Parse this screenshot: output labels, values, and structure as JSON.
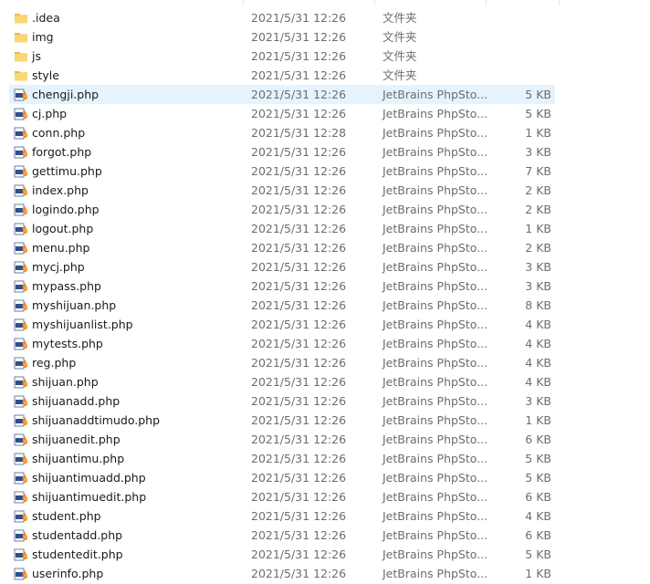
{
  "files": [
    {
      "name": ".idea",
      "date": "2021/5/31 12:26",
      "type": "文件夹",
      "size": "",
      "icon": "folder-icon",
      "selected": false
    },
    {
      "name": "img",
      "date": "2021/5/31 12:26",
      "type": "文件夹",
      "size": "",
      "icon": "folder-icon",
      "selected": false
    },
    {
      "name": "js",
      "date": "2021/5/31 12:26",
      "type": "文件夹",
      "size": "",
      "icon": "folder-icon",
      "selected": false
    },
    {
      "name": "style",
      "date": "2021/5/31 12:26",
      "type": "文件夹",
      "size": "",
      "icon": "folder-icon",
      "selected": false
    },
    {
      "name": "chengji.php",
      "date": "2021/5/31 12:26",
      "type": "JetBrains PhpSto...",
      "size": "5 KB",
      "icon": "php-file-icon",
      "selected": true
    },
    {
      "name": "cj.php",
      "date": "2021/5/31 12:26",
      "type": "JetBrains PhpSto...",
      "size": "5 KB",
      "icon": "php-file-icon",
      "selected": false
    },
    {
      "name": "conn.php",
      "date": "2021/5/31 12:28",
      "type": "JetBrains PhpSto...",
      "size": "1 KB",
      "icon": "php-file-icon",
      "selected": false
    },
    {
      "name": "forgot.php",
      "date": "2021/5/31 12:26",
      "type": "JetBrains PhpSto...",
      "size": "3 KB",
      "icon": "php-file-icon",
      "selected": false
    },
    {
      "name": "gettimu.php",
      "date": "2021/5/31 12:26",
      "type": "JetBrains PhpSto...",
      "size": "7 KB",
      "icon": "php-file-icon",
      "selected": false
    },
    {
      "name": "index.php",
      "date": "2021/5/31 12:26",
      "type": "JetBrains PhpSto...",
      "size": "2 KB",
      "icon": "php-file-icon",
      "selected": false
    },
    {
      "name": "logindo.php",
      "date": "2021/5/31 12:26",
      "type": "JetBrains PhpSto...",
      "size": "2 KB",
      "icon": "php-file-icon",
      "selected": false
    },
    {
      "name": "logout.php",
      "date": "2021/5/31 12:26",
      "type": "JetBrains PhpSto...",
      "size": "1 KB",
      "icon": "php-file-icon",
      "selected": false
    },
    {
      "name": "menu.php",
      "date": "2021/5/31 12:26",
      "type": "JetBrains PhpSto...",
      "size": "2 KB",
      "icon": "php-file-icon",
      "selected": false
    },
    {
      "name": "mycj.php",
      "date": "2021/5/31 12:26",
      "type": "JetBrains PhpSto...",
      "size": "3 KB",
      "icon": "php-file-icon",
      "selected": false
    },
    {
      "name": "mypass.php",
      "date": "2021/5/31 12:26",
      "type": "JetBrains PhpSto...",
      "size": "3 KB",
      "icon": "php-file-icon",
      "selected": false
    },
    {
      "name": "myshijuan.php",
      "date": "2021/5/31 12:26",
      "type": "JetBrains PhpSto...",
      "size": "8 KB",
      "icon": "php-file-icon",
      "selected": false
    },
    {
      "name": "myshijuanlist.php",
      "date": "2021/5/31 12:26",
      "type": "JetBrains PhpSto...",
      "size": "4 KB",
      "icon": "php-file-icon",
      "selected": false
    },
    {
      "name": "mytests.php",
      "date": "2021/5/31 12:26",
      "type": "JetBrains PhpSto...",
      "size": "4 KB",
      "icon": "php-file-icon",
      "selected": false
    },
    {
      "name": "reg.php",
      "date": "2021/5/31 12:26",
      "type": "JetBrains PhpSto...",
      "size": "4 KB",
      "icon": "php-file-icon",
      "selected": false
    },
    {
      "name": "shijuan.php",
      "date": "2021/5/31 12:26",
      "type": "JetBrains PhpSto...",
      "size": "4 KB",
      "icon": "php-file-icon",
      "selected": false
    },
    {
      "name": "shijuanadd.php",
      "date": "2021/5/31 12:26",
      "type": "JetBrains PhpSto...",
      "size": "3 KB",
      "icon": "php-file-icon",
      "selected": false
    },
    {
      "name": "shijuanaddtimudo.php",
      "date": "2021/5/31 12:26",
      "type": "JetBrains PhpSto...",
      "size": "1 KB",
      "icon": "php-file-icon",
      "selected": false
    },
    {
      "name": "shijuanedit.php",
      "date": "2021/5/31 12:26",
      "type": "JetBrains PhpSto...",
      "size": "6 KB",
      "icon": "php-file-icon",
      "selected": false
    },
    {
      "name": "shijuantimu.php",
      "date": "2021/5/31 12:26",
      "type": "JetBrains PhpSto...",
      "size": "5 KB",
      "icon": "php-file-icon",
      "selected": false
    },
    {
      "name": "shijuantimuadd.php",
      "date": "2021/5/31 12:26",
      "type": "JetBrains PhpSto...",
      "size": "5 KB",
      "icon": "php-file-icon",
      "selected": false
    },
    {
      "name": "shijuantimuedit.php",
      "date": "2021/5/31 12:26",
      "type": "JetBrains PhpSto...",
      "size": "6 KB",
      "icon": "php-file-icon",
      "selected": false
    },
    {
      "name": "student.php",
      "date": "2021/5/31 12:26",
      "type": "JetBrains PhpSto...",
      "size": "4 KB",
      "icon": "php-file-icon",
      "selected": false
    },
    {
      "name": "studentadd.php",
      "date": "2021/5/31 12:26",
      "type": "JetBrains PhpSto...",
      "size": "6 KB",
      "icon": "php-file-icon",
      "selected": false
    },
    {
      "name": "studentedit.php",
      "date": "2021/5/31 12:26",
      "type": "JetBrains PhpSto...",
      "size": "5 KB",
      "icon": "php-file-icon",
      "selected": false
    },
    {
      "name": "userinfo.php",
      "date": "2021/5/31 12:26",
      "type": "JetBrains PhpSto...",
      "size": "1 KB",
      "icon": "php-file-icon",
      "selected": false
    }
  ],
  "colors": {
    "folder_body": "#f8d775",
    "folder_tab": "#e8b940",
    "selection": "#e5f3ff",
    "secondary_text": "#6d6d6d"
  }
}
